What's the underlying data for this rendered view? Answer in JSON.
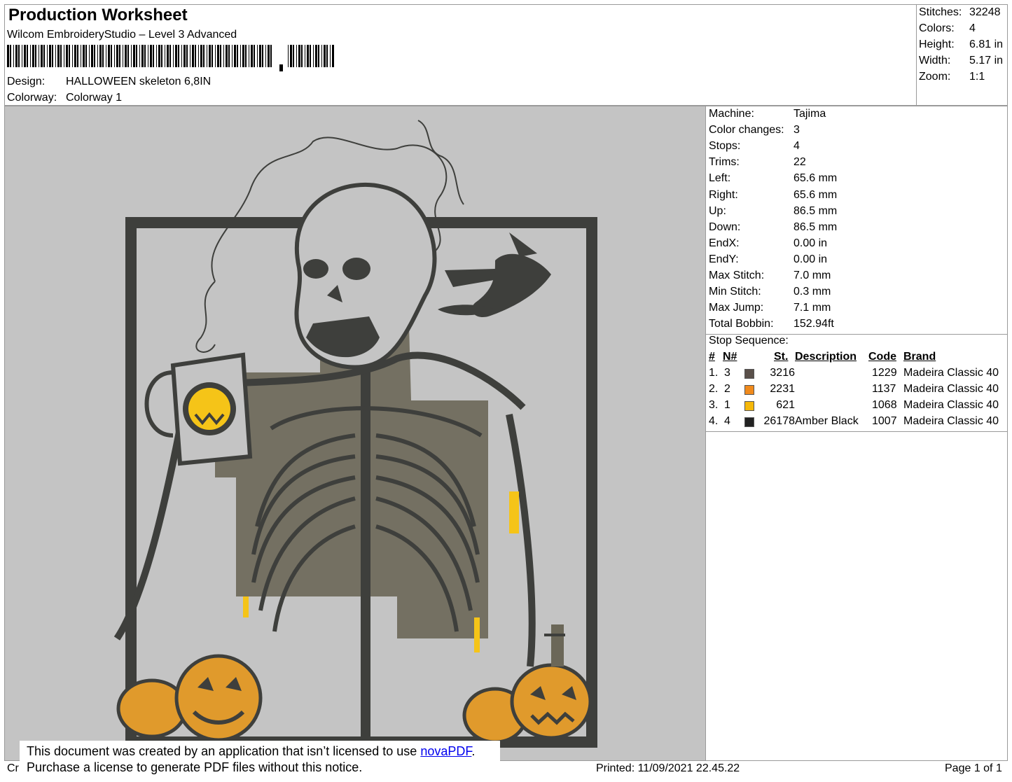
{
  "header": {
    "title": "Production Worksheet",
    "software": "Wilcom EmbroideryStudio – Level 3 Advanced",
    "design_label": "Design:",
    "design_value": "HALLOWEEN skeleton 6,8IN",
    "colorway_label": "Colorway:",
    "colorway_value": "Colorway 1"
  },
  "stats": {
    "stitches_label": "Stitches:",
    "stitches_value": "32248",
    "colors_label": "Colors:",
    "colors_value": "4",
    "height_label": "Height:",
    "height_value": "6.81 in",
    "width_label": "Width:",
    "width_value": "5.17 in",
    "zoom_label": "Zoom:",
    "zoom_value": "1:1"
  },
  "machine_info": [
    {
      "label": "Machine:",
      "value": "Tajima"
    },
    {
      "label": "Color changes:",
      "value": "3"
    },
    {
      "label": "Stops:",
      "value": "4"
    },
    {
      "label": "Trims:",
      "value": "22"
    },
    {
      "label": "Left:",
      "value": "65.6 mm"
    },
    {
      "label": "Right:",
      "value": "65.6 mm"
    },
    {
      "label": "Up:",
      "value": "86.5 mm"
    },
    {
      "label": "Down:",
      "value": "86.5 mm"
    },
    {
      "label": "EndX:",
      "value": "0.00 in"
    },
    {
      "label": "EndY:",
      "value": "0.00 in"
    },
    {
      "label": "Max Stitch:",
      "value": "7.0 mm"
    },
    {
      "label": "Min Stitch:",
      "value": "0.3 mm"
    },
    {
      "label": "Max Jump:",
      "value": "7.1 mm"
    },
    {
      "label": "Total Bobbin:",
      "value": "152.94ft"
    }
  ],
  "stop_sequence": {
    "title": "Stop Sequence:",
    "headers": {
      "num": "#",
      "n": "N#",
      "st": "St.",
      "desc": "Description",
      "code": "Code",
      "brand": "Brand"
    },
    "rows": [
      {
        "num": "1.",
        "n": "3",
        "color": "#5a504a",
        "st": "3216",
        "desc": "",
        "code": "1229",
        "brand": "Madeira Classic 40"
      },
      {
        "num": "2.",
        "n": "2",
        "color": "#f08a1c",
        "st": "2231",
        "desc": "",
        "code": "1137",
        "brand": "Madeira Classic 40"
      },
      {
        "num": "3.",
        "n": "1",
        "color": "#f5b80a",
        "st": "621",
        "desc": "",
        "code": "1068",
        "brand": "Madeira Classic 40"
      },
      {
        "num": "4.",
        "n": "4",
        "color": "#222222",
        "st": "26178",
        "desc": "Amber Black",
        "code": "1007",
        "brand": "Madeira Classic 40"
      }
    ]
  },
  "notice": {
    "line1_pre": "This document was created by an application that isn’t licensed to use ",
    "link": "novaPDF",
    "line1_post": ".",
    "line2": "Purchase a license to generate PDF files without this notice."
  },
  "footer": {
    "cr": "Cr",
    "printed": "Printed: 11/09/2021 22.45.22",
    "page": "Page 1 of 1"
  },
  "colors": {
    "canvas_bg": "#c4c4c4",
    "outline": "#3e3f3c",
    "tombstone": "#6b6758",
    "pumpkin": "#e09a2c",
    "yellow": "#f5c418"
  }
}
